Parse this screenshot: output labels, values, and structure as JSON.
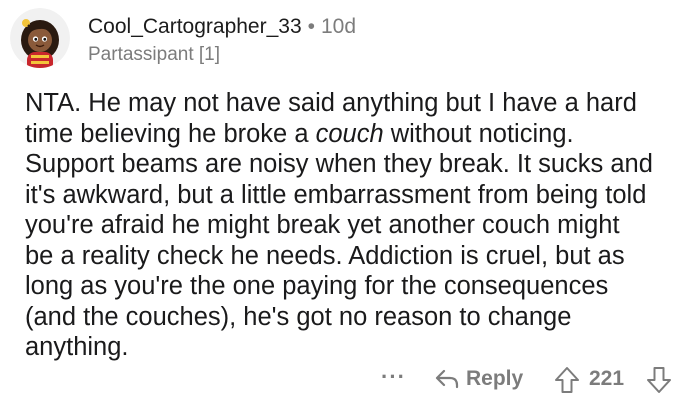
{
  "comment": {
    "author": "Cool_Cartographer_33",
    "separator": "•",
    "age": "10d",
    "flair": "Partassipant [1]",
    "body_lines": [
      "NTA. He may not have said anything but I have a hard",
      "time believing he broke a ",
      "couch",
      " without noticing.",
      "Support beams are noisy when they break. It sucks and",
      "it's awkward, but a little embarrassment from being told",
      "you're afraid he might break yet another couch might",
      "be a reality check he needs. Addiction is cruel, but as",
      "long as you're the one paying for the consequences",
      "(and the couches), he's got no reason to change",
      "anything."
    ]
  },
  "actions": {
    "more_label": "···",
    "reply_label": "Reply",
    "score": "221"
  },
  "icons": {
    "reply": "reply-arrow-icon",
    "upvote": "upvote-arrow-icon",
    "downvote": "downvote-arrow-icon",
    "avatar": "user-avatar"
  },
  "colors": {
    "meta_gray": "#7c7c7c",
    "text": "#1a1a1b"
  }
}
